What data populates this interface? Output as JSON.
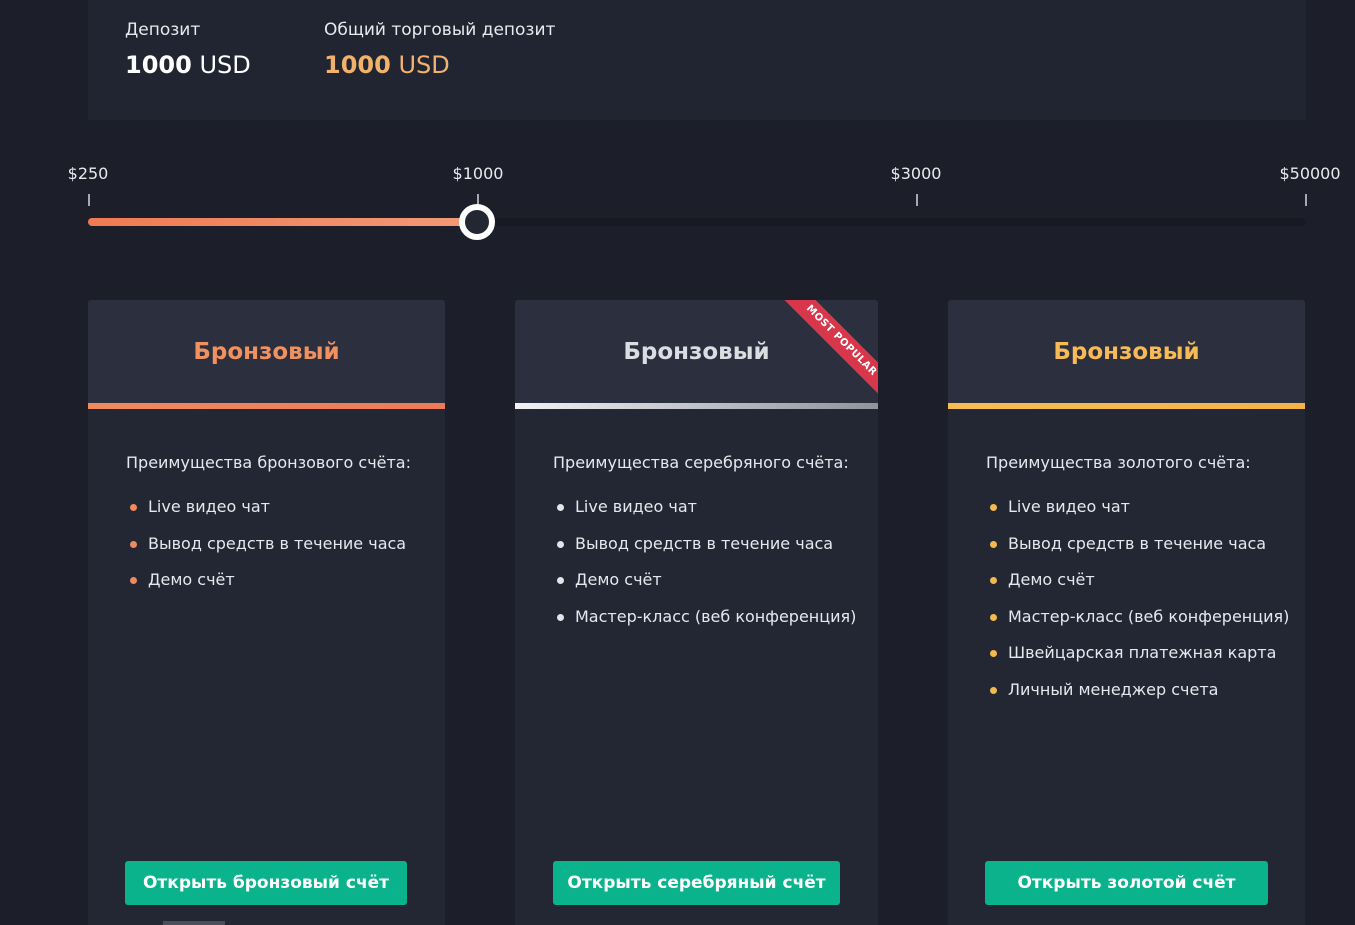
{
  "summary": {
    "deposit_label": "Депозит",
    "deposit_amount": "1000",
    "deposit_currency": "USD",
    "total_label": "Общий торговый депозит",
    "total_amount": "1000",
    "total_currency": "USD"
  },
  "slider": {
    "ticks": [
      "$250",
      "$1000",
      "$3000",
      "$50000"
    ],
    "value_label": "$1000",
    "fill_fraction": 0.319
  },
  "cards": [
    {
      "title": "Бронзовый",
      "title_color": "#f0915f",
      "accent": "linear-gradient(90deg, #f08a5d, #ee7a57)",
      "dot_color": "#f08a5d",
      "benefit_title": "Преимущества бронзового счёта:",
      "benefits": [
        "Live видео чат",
        "Вывод средств в течение часа",
        "Демо счёт"
      ],
      "button": "Открыть бронзовый счёт"
    },
    {
      "title": "Бронзовый",
      "title_color": "#dcdde2",
      "accent": "linear-gradient(90deg, #f1f2f4, #8f939c)",
      "dot_color": "#e4e5e9",
      "benefit_title": "Преимущества серебряного счёта:",
      "benefits": [
        "Live видео чат",
        "Вывод средств в течение часа",
        "Демо счёт",
        "Мастер-класс (веб конференция)"
      ],
      "button": "Открыть серебряный счёт",
      "ribbon": "MOST POPULAR"
    },
    {
      "title": "Бронзовый",
      "title_color": "#f6bb57",
      "accent": "linear-gradient(90deg, #f6be52, #f4b347)",
      "dot_color": "#f4b84e",
      "benefit_title": "Преимущества золотого счёта:",
      "benefits": [
        "Live видео чат",
        "Вывод средств в течение часа",
        "Демо счёт",
        "Мастер-класс (веб конференция)",
        "Швейцарская платежная карта",
        "Личный менеджер счета"
      ],
      "button": "Открыть золотой счёт"
    }
  ]
}
